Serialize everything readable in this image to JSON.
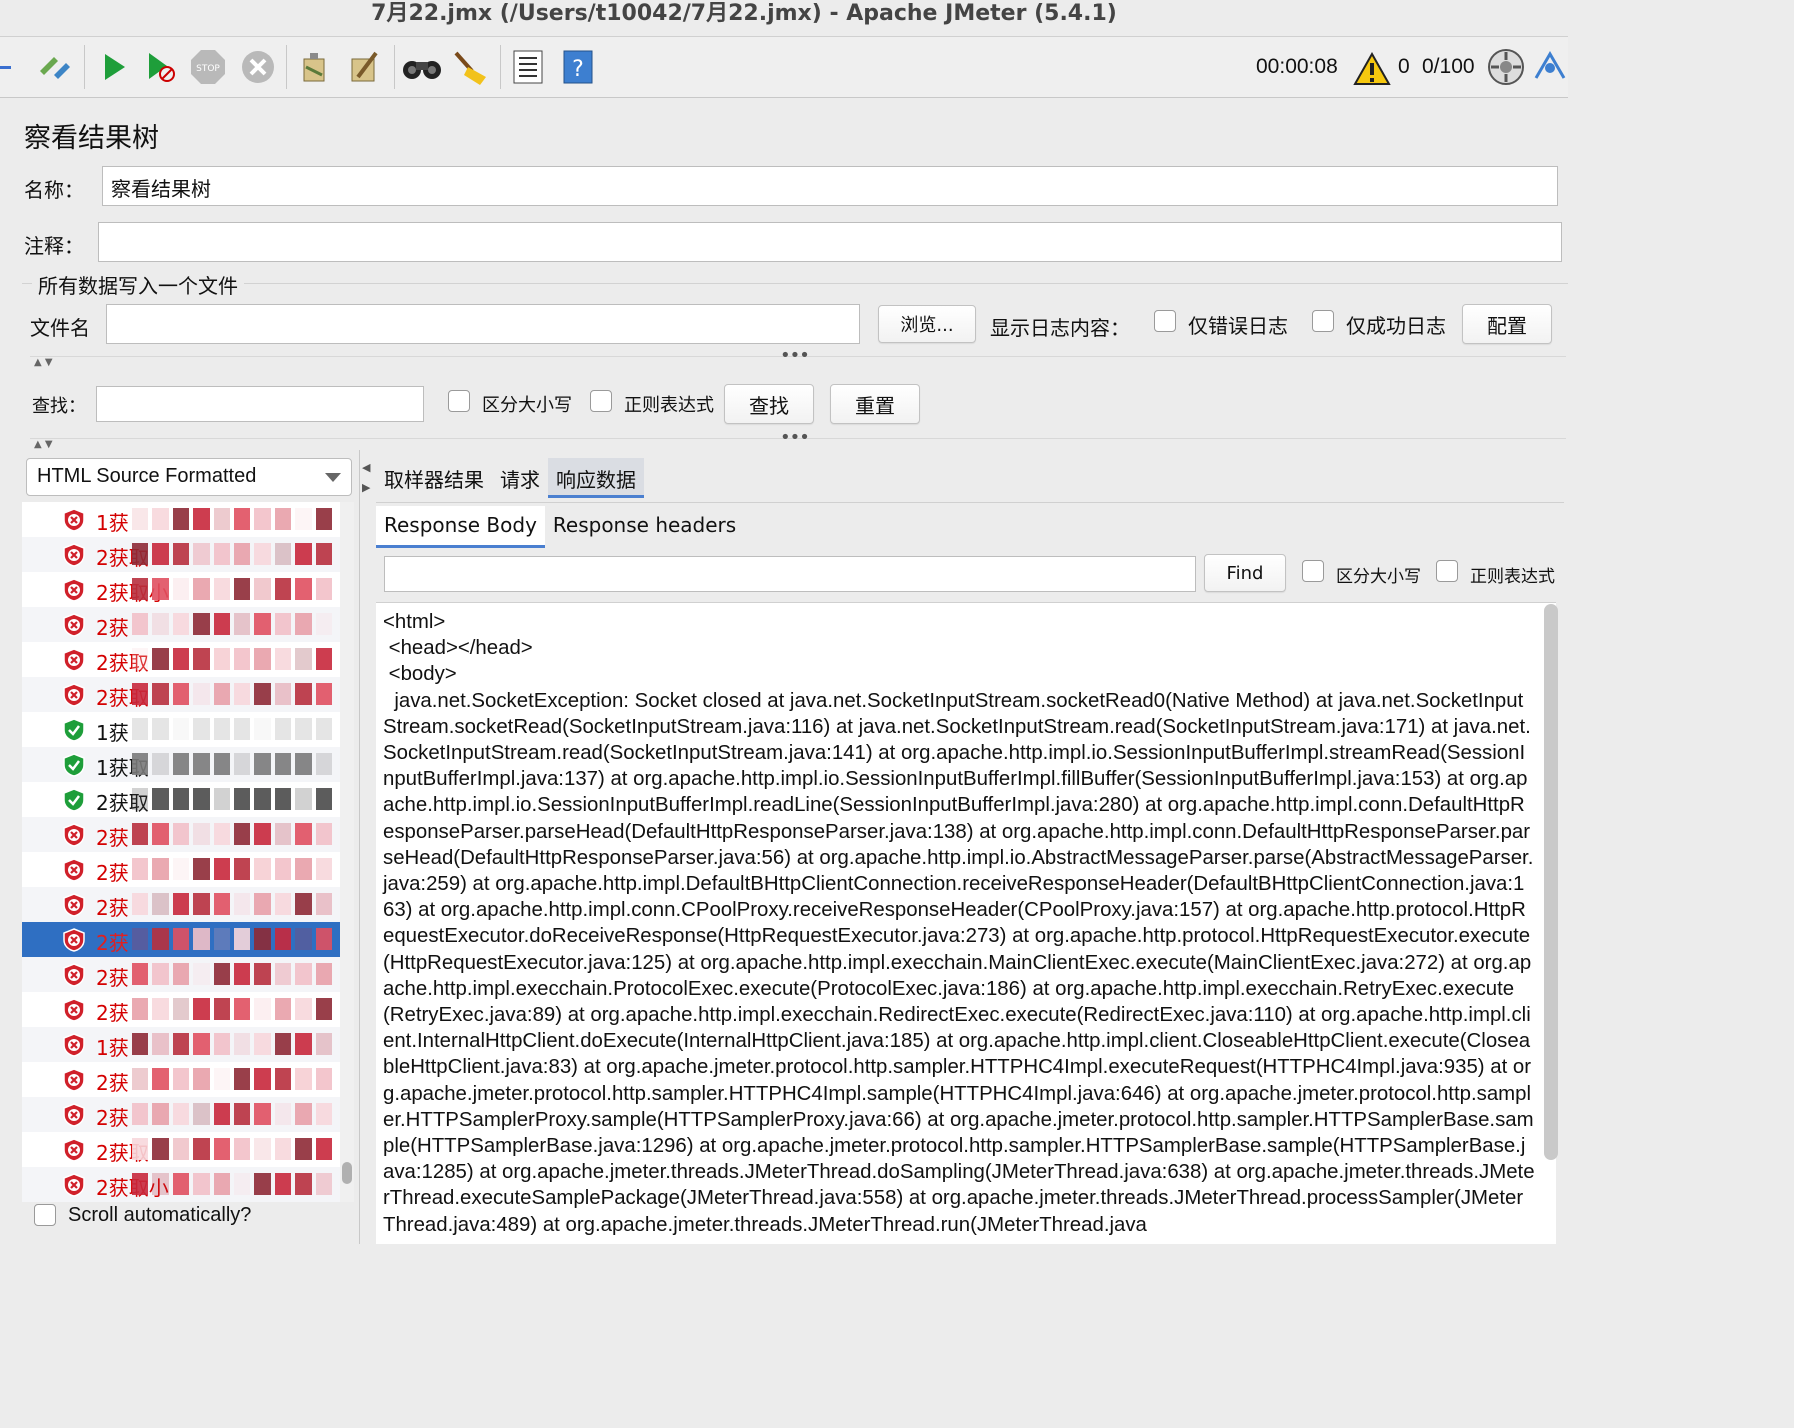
{
  "window": {
    "title": "7月22.jmx (/Users/t10042/7月22.jmx) - Apache JMeter (5.4.1)"
  },
  "toolbar": {
    "elapsed": "00:00:08",
    "warning_count": "0",
    "threads": "0/100"
  },
  "panel": {
    "title": "察看结果树",
    "name_label": "名称：",
    "name_value": "察看结果树",
    "comment_label": "注释：",
    "comment_value": "",
    "file_section": "所有数据写入一个文件",
    "filename_label": "文件名",
    "filename_value": "",
    "browse_button": "浏览...",
    "log_label": "显示日志内容：",
    "errors_only": "仅错误日志",
    "success_only": "仅成功日志",
    "configure_button": "配置",
    "search_label": "查找：",
    "search_value": "",
    "case_sensitive": "区分大小写",
    "regex": "正则表达式",
    "search_button": "查找",
    "reset_button": "重置"
  },
  "renderer": {
    "selected": "HTML Source Formatted"
  },
  "results": [
    {
      "label": "1获",
      "status": "error"
    },
    {
      "label": "2获取",
      "status": "error"
    },
    {
      "label": "2获取小",
      "status": "error"
    },
    {
      "label": "2获",
      "status": "error"
    },
    {
      "label": "2获取",
      "status": "error"
    },
    {
      "label": "2获取",
      "status": "error"
    },
    {
      "label": "1获",
      "status": "success"
    },
    {
      "label": "1获取",
      "status": "success"
    },
    {
      "label": "2获取",
      "status": "success"
    },
    {
      "label": "2获",
      "status": "error"
    },
    {
      "label": "2获",
      "status": "error"
    },
    {
      "label": "2获",
      "status": "error"
    },
    {
      "label": "2获",
      "status": "error",
      "selected": true
    },
    {
      "label": "2获",
      "status": "error"
    },
    {
      "label": "2获",
      "status": "error"
    },
    {
      "label": "1获",
      "status": "error"
    },
    {
      "label": "2获",
      "status": "error"
    },
    {
      "label": "2获",
      "status": "error"
    },
    {
      "label": "2获取",
      "status": "error"
    },
    {
      "label": "2获取小",
      "status": "error"
    }
  ],
  "scroll_auto": "Scroll automatically?",
  "tabs": [
    "取样器结果",
    "请求",
    "响应数据"
  ],
  "active_tab": 2,
  "subtabs": [
    "Response Body",
    "Response headers"
  ],
  "response_search": {
    "value": "",
    "find_button": "Find",
    "case_sensitive": "区分大小写",
    "regex": "正则表达式"
  },
  "response_body": "<html>\n <head></head>\n <body>\n  java.net.SocketException: Socket closed at java.net.SocketInputStream.socketRead0(Native Method) at java.net.SocketInputStream.socketRead(SocketInputStream.java:116) at java.net.SocketInputStream.read(SocketInputStream.java:171) at java.net.SocketInputStream.read(SocketInputStream.java:141) at org.apache.http.impl.io.SessionInputBufferImpl.streamRead(SessionInputBufferImpl.java:137) at org.apache.http.impl.io.SessionInputBufferImpl.fillBuffer(SessionInputBufferImpl.java:153) at org.apache.http.impl.io.SessionInputBufferImpl.readLine(SessionInputBufferImpl.java:280) at org.apache.http.impl.conn.DefaultHttpResponseParser.parseHead(DefaultHttpResponseParser.java:138) at org.apache.http.impl.conn.DefaultHttpResponseParser.parseHead(DefaultHttpResponseParser.java:56) at org.apache.http.impl.io.AbstractMessageParser.parse(AbstractMessageParser.java:259) at org.apache.http.impl.DefaultBHttpClientConnection.receiveResponseHeader(DefaultBHttpClientConnection.java:163) at org.apache.http.impl.conn.CPoolProxy.receiveResponseHeader(CPoolProxy.java:157) at org.apache.http.protocol.HttpRequestExecutor.doReceiveResponse(HttpRequestExecutor.java:273) at org.apache.http.protocol.HttpRequestExecutor.execute(HttpRequestExecutor.java:125) at org.apache.http.impl.execchain.MainClientExec.execute(MainClientExec.java:272) at org.apache.http.impl.execchain.ProtocolExec.execute(ProtocolExec.java:186) at org.apache.http.impl.execchain.RetryExec.execute(RetryExec.java:89) at org.apache.http.impl.execchain.RedirectExec.execute(RedirectExec.java:110) at org.apache.http.impl.client.InternalHttpClient.doExecute(InternalHttpClient.java:185) at org.apache.http.impl.client.CloseableHttpClient.execute(CloseableHttpClient.java:83) at org.apache.jmeter.protocol.http.sampler.HTTPHC4Impl.executeRequest(HTTPHC4Impl.java:935) at org.apache.jmeter.protocol.http.sampler.HTTPHC4Impl.sample(HTTPHC4Impl.java:646) at org.apache.jmeter.protocol.http.sampler.HTTPSamplerProxy.sample(HTTPSamplerProxy.java:66) at org.apache.jmeter.protocol.http.sampler.HTTPSamplerBase.sample(HTTPSamplerBase.java:1296) at org.apache.jmeter.protocol.http.sampler.HTTPSamplerBase.sample(HTTPSamplerBase.java:1285) at org.apache.jmeter.threads.JMeterThread.doSampling(JMeterThread.java:638) at org.apache.jmeter.threads.JMeterThread.executeSamplePackage(JMeterThread.java:558) at org.apache.jmeter.threads.JMeterThread.processSampler(JMeterThread.java:489) at org.apache.jmeter.threads.JMeterThread.run(JMeterThread.java"
}
